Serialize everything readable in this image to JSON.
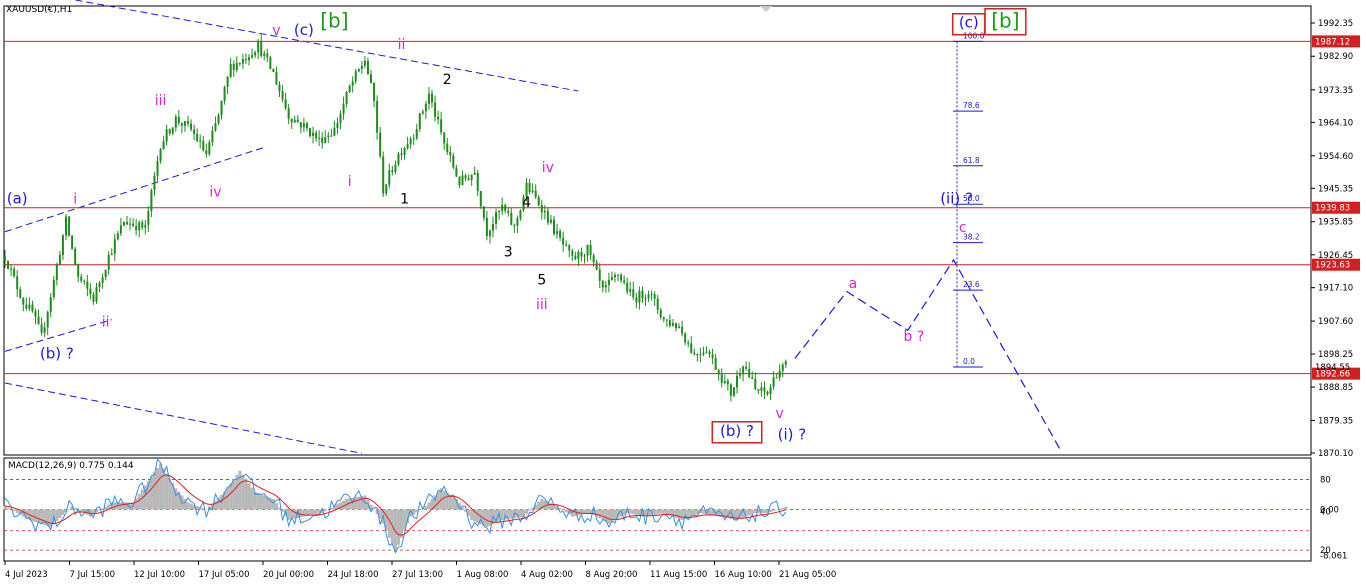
{
  "header": {
    "symbol": "XAUUSD(€),H1",
    "macd_label": "MACD(12,26,9) 0.775 0.144"
  },
  "colors": {
    "candle": "#1f8a1f",
    "hline": "#d21f1f",
    "trendline": "#1a1adb",
    "fib": "#1a1adb",
    "wave_magenta": "#e020d0",
    "wave_blue": "#1a1adb",
    "wave_green": "#1a9a1a",
    "wave_black": "#000000",
    "macd_hist": "#b8b8b8",
    "macd_line": "#3a8fe0",
    "signal_line": "#e02020"
  },
  "chart_data": {
    "type": "candlestick",
    "title": "",
    "symbol": "XAUUSD(€),H1",
    "x_tick_labels": [
      "4 Jul 2023",
      "7 Jul 15:00",
      "12 Jul 10:00",
      "17 Jul 05:00",
      "20 Jul 00:00",
      "24 Jul 18:00",
      "27 Jul 13:00",
      "1 Aug 08:00",
      "4 Aug 02:00",
      "8 Aug 20:00",
      "11 Aug 15:00",
      "16 Aug 10:00",
      "21 Aug 05:00"
    ],
    "y_ticks": [
      "1992.35",
      "1982.90",
      "1973.35",
      "1964.10",
      "1954.60",
      "1945.35",
      "1935.85",
      "1926.45",
      "1917.10",
      "1907.60",
      "1898.25",
      "1888.85",
      "1879.35",
      "1870.10"
    ],
    "ylim": [
      1870.1,
      1992.35
    ],
    "price_path": [
      {
        "t": 0,
        "p": 1926
      },
      {
        "t": 6,
        "p": 1913
      },
      {
        "t": 9,
        "p": 1910
      },
      {
        "t": 12,
        "p": 1903
      },
      {
        "t": 16,
        "p": 1919
      },
      {
        "t": 20,
        "p": 1936
      },
      {
        "t": 24,
        "p": 1920
      },
      {
        "t": 29,
        "p": 1914
      },
      {
        "t": 34,
        "p": 1926
      },
      {
        "t": 39,
        "p": 1936
      },
      {
        "t": 46,
        "p": 1934
      },
      {
        "t": 51,
        "p": 1958
      },
      {
        "t": 56,
        "p": 1965
      },
      {
        "t": 61,
        "p": 1962
      },
      {
        "t": 66,
        "p": 1955
      },
      {
        "t": 70,
        "p": 1966
      },
      {
        "t": 74,
        "p": 1980
      },
      {
        "t": 78,
        "p": 1982
      },
      {
        "t": 83,
        "p": 1986
      },
      {
        "t": 88,
        "p": 1978
      },
      {
        "t": 93,
        "p": 1966
      },
      {
        "t": 98,
        "p": 1963
      },
      {
        "t": 103,
        "p": 1959
      },
      {
        "t": 108,
        "p": 1962
      },
      {
        "t": 113,
        "p": 1974
      },
      {
        "t": 118,
        "p": 1982
      },
      {
        "t": 121,
        "p": 1970
      },
      {
        "t": 124,
        "p": 1945
      },
      {
        "t": 129,
        "p": 1955
      },
      {
        "t": 134,
        "p": 1961
      },
      {
        "t": 139,
        "p": 1972
      },
      {
        "t": 144,
        "p": 1958
      },
      {
        "t": 149,
        "p": 1947
      },
      {
        "t": 154,
        "p": 1950
      },
      {
        "t": 158,
        "p": 1933
      },
      {
        "t": 163,
        "p": 1940
      },
      {
        "t": 167,
        "p": 1934
      },
      {
        "t": 171,
        "p": 1946
      },
      {
        "t": 176,
        "p": 1940
      },
      {
        "t": 181,
        "p": 1932
      },
      {
        "t": 186,
        "p": 1925
      },
      {
        "t": 191,
        "p": 1928
      },
      {
        "t": 196,
        "p": 1916
      },
      {
        "t": 201,
        "p": 1921
      },
      {
        "t": 206,
        "p": 1914
      },
      {
        "t": 211,
        "p": 1916
      },
      {
        "t": 216,
        "p": 1908
      },
      {
        "t": 221,
        "p": 1906
      },
      {
        "t": 226,
        "p": 1898
      },
      {
        "t": 230,
        "p": 1900
      },
      {
        "t": 234,
        "p": 1893
      },
      {
        "t": 238,
        "p": 1887
      },
      {
        "t": 242,
        "p": 1896
      },
      {
        "t": 246,
        "p": 1888
      },
      {
        "t": 250,
        "p": 1887
      },
      {
        "t": 253,
        "p": 1893
      },
      {
        "t": 256,
        "p": 1895
      }
    ],
    "horizontal_levels": [
      {
        "value": 1987.12,
        "label": "1987.12"
      },
      {
        "value": 1939.83,
        "label": "1939.83"
      },
      {
        "value": 1923.63,
        "label": "1923.63"
      },
      {
        "value": 1892.66,
        "label": "1892.66"
      }
    ],
    "current_price_label": "1894.55",
    "fibonacci": {
      "high": 1987.12,
      "low": 1894.55,
      "levels": [
        {
          "ratio": 1.0,
          "label": "100.0"
        },
        {
          "ratio": 0.786,
          "label": "78.6"
        },
        {
          "ratio": 0.618,
          "label": "61.8"
        },
        {
          "ratio": 0.5,
          "label": "50.0"
        },
        {
          "ratio": 0.382,
          "label": "38.2"
        },
        {
          "ratio": 0.236,
          "label": "23.6"
        },
        {
          "ratio": 0.0,
          "label": "0.0"
        }
      ]
    },
    "projection": [
      {
        "t": 259,
        "p": 1897
      },
      {
        "t": 276,
        "p": 1916
      },
      {
        "t": 296,
        "p": 1905
      },
      {
        "t": 311,
        "p": 1925
      },
      {
        "t": 346,
        "p": 1871
      }
    ],
    "trendlines": [
      {
        "t1": 16,
        "p1": 2000,
        "t2": 188,
        "p2": 1973
      },
      {
        "t1": 0,
        "p1": 1899,
        "t2": 35,
        "p2": 1908
      },
      {
        "t1": 0,
        "p1": 1933,
        "t2": 85,
        "p2": 1957
      },
      {
        "t1": 0,
        "p1": 1890,
        "t2": 117,
        "p2": 1870
      }
    ],
    "wave_labels": [
      {
        "text": "v",
        "t": 89,
        "p": 1989,
        "color": "magenta"
      },
      {
        "text": "(c)",
        "t": 98,
        "p": 1989,
        "color": "blue"
      },
      {
        "text": "[b]",
        "t": 108,
        "p": 1991,
        "color": "green"
      },
      {
        "text": "ii",
        "t": 130,
        "p": 1985,
        "color": "magenta"
      },
      {
        "text": "2",
        "t": 145,
        "p": 1975,
        "color": "black"
      },
      {
        "text": "iii",
        "t": 51,
        "p": 1969,
        "color": "magenta"
      },
      {
        "text": "iv",
        "t": 69,
        "p": 1943,
        "color": "magenta"
      },
      {
        "text": "i",
        "t": 113,
        "p": 1946,
        "color": "magenta"
      },
      {
        "text": "1",
        "t": 131,
        "p": 1941,
        "color": "black"
      },
      {
        "text": "iv",
        "t": 178,
        "p": 1950,
        "color": "magenta"
      },
      {
        "text": "4",
        "t": 171,
        "p": 1940,
        "color": "black"
      },
      {
        "text": "3",
        "t": 165,
        "p": 1926,
        "color": "black"
      },
      {
        "text": "5",
        "t": 176,
        "p": 1918,
        "color": "black"
      },
      {
        "text": "iii",
        "t": 176,
        "p": 1911,
        "color": "magenta"
      },
      {
        "text": "(a)",
        "t": 4,
        "p": 1941,
        "color": "blue"
      },
      {
        "text": "i",
        "t": 23,
        "p": 1941,
        "color": "magenta"
      },
      {
        "text": "ii",
        "t": 33,
        "p": 1906,
        "color": "magenta"
      },
      {
        "text": "(b) ?",
        "t": 17,
        "p": 1897,
        "color": "blue"
      },
      {
        "text": "a",
        "t": 278,
        "p": 1917,
        "color": "magenta"
      },
      {
        "text": "b ?",
        "t": 298,
        "p": 1902,
        "color": "magenta"
      },
      {
        "text": "c",
        "t": 314,
        "p": 1933,
        "color": "magenta"
      },
      {
        "text": "(ii) ?",
        "t": 312,
        "p": 1941,
        "color": "blue"
      },
      {
        "text": "v",
        "t": 254,
        "p": 1880,
        "color": "magenta"
      },
      {
        "text": "(i) ?",
        "t": 258,
        "p": 1874,
        "color": "blue"
      },
      {
        "text": "(b) ?",
        "t": 240,
        "p": 1875,
        "color": "blue",
        "boxed": true
      },
      {
        "text": "(c)",
        "t": 316,
        "p": 1991,
        "color": "blue",
        "boxed": true
      },
      {
        "text": "[b]",
        "t": 328,
        "p": 1991,
        "color": "green",
        "boxed": true
      }
    ],
    "macd": {
      "label": "MACD(12,26,9) 0.775 0.144",
      "y_ticks": [
        "80",
        "0.00",
        "40",
        "20",
        "-8.061"
      ],
      "ylim": [
        -14,
        14
      ],
      "levels": [
        8.5,
        0,
        -6,
        -11.5
      ],
      "hist_path": [
        {
          "t": 0,
          "v": 1
        },
        {
          "t": 8,
          "v": -3
        },
        {
          "t": 15,
          "v": -5
        },
        {
          "t": 22,
          "v": 1
        },
        {
          "t": 28,
          "v": -2
        },
        {
          "t": 35,
          "v": 2
        },
        {
          "t": 42,
          "v": 2
        },
        {
          "t": 47,
          "v": 8
        },
        {
          "t": 51,
          "v": 13
        },
        {
          "t": 56,
          "v": 6
        },
        {
          "t": 60,
          "v": 2
        },
        {
          "t": 66,
          "v": 0
        },
        {
          "t": 72,
          "v": 5
        },
        {
          "t": 77,
          "v": 11
        },
        {
          "t": 82,
          "v": 5
        },
        {
          "t": 88,
          "v": 3
        },
        {
          "t": 93,
          "v": -3
        },
        {
          "t": 98,
          "v": -2
        },
        {
          "t": 104,
          "v": -1
        },
        {
          "t": 112,
          "v": 3
        },
        {
          "t": 118,
          "v": 4
        },
        {
          "t": 124,
          "v": -4
        },
        {
          "t": 128,
          "v": -12
        },
        {
          "t": 133,
          "v": -2
        },
        {
          "t": 138,
          "v": 1
        },
        {
          "t": 143,
          "v": 6
        },
        {
          "t": 148,
          "v": 3
        },
        {
          "t": 153,
          "v": -3
        },
        {
          "t": 158,
          "v": -5
        },
        {
          "t": 163,
          "v": -3
        },
        {
          "t": 170,
          "v": -2
        },
        {
          "t": 176,
          "v": 3
        },
        {
          "t": 181,
          "v": 1
        },
        {
          "t": 186,
          "v": -2
        },
        {
          "t": 192,
          "v": -1
        },
        {
          "t": 198,
          "v": -4
        },
        {
          "t": 204,
          "v": -1
        },
        {
          "t": 210,
          "v": -2
        },
        {
          "t": 216,
          "v": -1
        },
        {
          "t": 222,
          "v": -3
        },
        {
          "t": 228,
          "v": -1
        },
        {
          "t": 234,
          "v": -2
        },
        {
          "t": 240,
          "v": -3
        },
        {
          "t": 246,
          "v": -1
        },
        {
          "t": 250,
          "v": -1
        },
        {
          "t": 256,
          "v": 0.8
        }
      ]
    }
  }
}
